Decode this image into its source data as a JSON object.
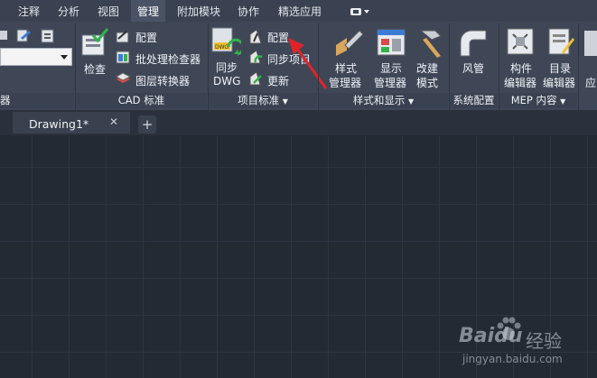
{
  "ribbon_tabs": [
    "注释",
    "分析",
    "视图",
    "管理",
    "附加模块",
    "协作",
    "精选应用"
  ],
  "active_tab": "管理",
  "panels": {
    "left_partial": {
      "footer": "器"
    },
    "cad_standard": {
      "title": "CAD 标准",
      "check_label": "检查",
      "config_label": "配置",
      "batch_label": "批处理检查器",
      "layer_label": "图层转换器"
    },
    "project_standard": {
      "title": "项目标准",
      "sync_label_1": "同步",
      "sync_label_2": "DWG",
      "config_label": "配置",
      "sync_project_label": "同步项目",
      "update_label": "更新"
    },
    "style_display": {
      "title": "样式和显示",
      "style_manager_1": "样式",
      "style_manager_2": "管理器",
      "display_manager_1": "显示",
      "display_manager_2": "管理器",
      "modify_style_1": "改建",
      "modify_style_2": "模式"
    },
    "system_config": {
      "title": "系统配置",
      "duct_label": "风管"
    },
    "mep_content": {
      "title": "MEP 内容",
      "part_editor_1": "构件",
      "part_editor_2": "编辑器",
      "catalog_editor_1": "目录",
      "catalog_editor_2": "编辑器"
    },
    "right_partial": {
      "label": "应"
    }
  },
  "doc_tabs": {
    "active": "Drawing1*",
    "close_glyph": "✕",
    "add_glyph": "+"
  },
  "watermark": {
    "brand": "Baidu",
    "sub": "经验",
    "url": "jingyan.baidu.com"
  },
  "colors": {
    "accent_arrow": "#e0242a",
    "ribbon_bg": "#3f4757",
    "canvas_bg": "#232a34"
  }
}
